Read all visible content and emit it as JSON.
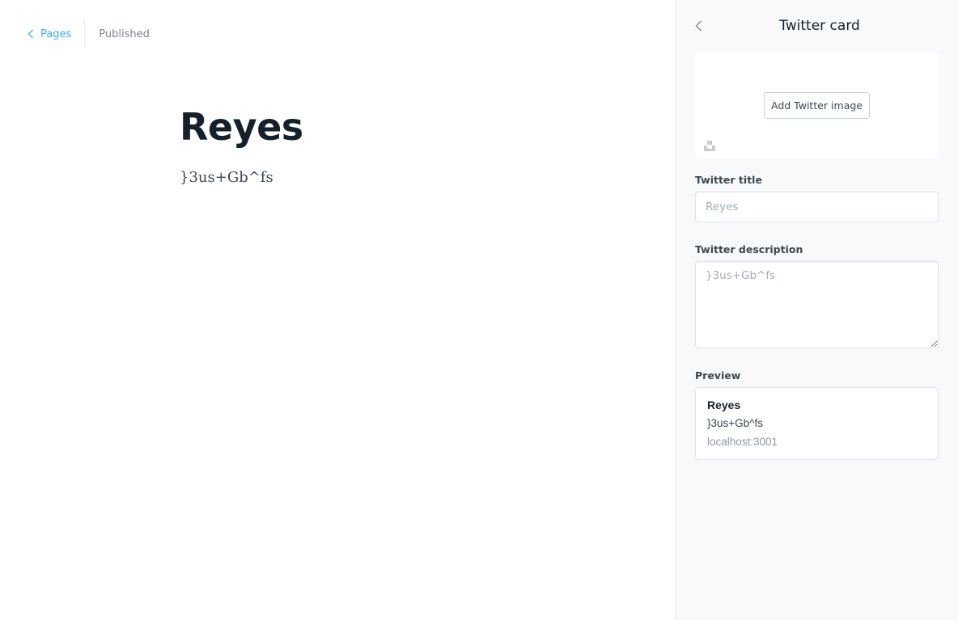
{
  "topbar": {
    "back_label": "Pages",
    "status": "Published"
  },
  "post": {
    "title": "Reyes",
    "body": "}3us+Gb^fs"
  },
  "panel": {
    "title": "Twitter card",
    "add_image_label": "Add Twitter image",
    "twitter_title_label": "Twitter title",
    "twitter_title_placeholder": "Reyes",
    "twitter_title_value": "",
    "twitter_description_label": "Twitter description",
    "twitter_description_placeholder": "}3us+Gb^fs",
    "twitter_description_value": "",
    "preview_label": "Preview",
    "preview": {
      "title": "Reyes",
      "description": "}3us+Gb^fs",
      "url": "localhost:3001"
    }
  },
  "icons": {
    "back": "chevron-left-icon",
    "unsplash": "unsplash-icon"
  },
  "colors": {
    "accent": "#3eb0ef",
    "panel_bg": "#f8f9fa",
    "text_dark": "#15212a"
  }
}
